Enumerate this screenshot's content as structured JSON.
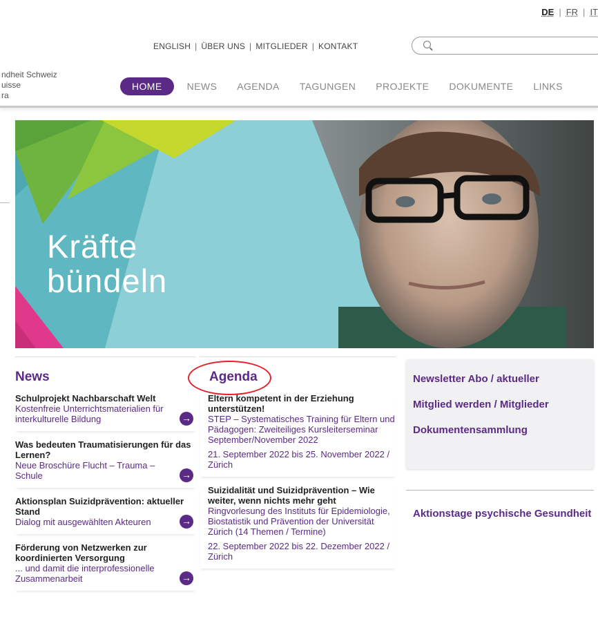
{
  "languages": [
    {
      "label": "DE",
      "active": true
    },
    {
      "label": "FR",
      "active": false
    },
    {
      "label": "IT",
      "active": false
    }
  ],
  "top_links": [
    "ENGLISH",
    "ÜBER UNS",
    "MITGLIEDER",
    "KONTAKT"
  ],
  "search": {
    "value": "",
    "placeholder": ""
  },
  "brand": {
    "line1": "ndheit Schweiz",
    "line2": "uisse",
    "line3": "ra"
  },
  "nav": [
    "HOME",
    "NEWS",
    "AGENDA",
    "TAGUNGEN",
    "PROJEKTE",
    "DOKUMENTE",
    "LINKS"
  ],
  "hero": {
    "line1": "Kräfte",
    "line2": "bündeln"
  },
  "news": {
    "heading": "News",
    "items": [
      {
        "title": "Schulprojekt Nachbarschaft Welt",
        "text": "Kostenfreie Unterrichtsmaterialien für interkulturelle Bildung"
      },
      {
        "title": "Was bedeuten Traumatisierungen für das Lernen?",
        "text": "Neue Broschüre Flucht – Trauma – Schule"
      },
      {
        "title": "Aktionsplan Suizidprävention: aktueller Stand",
        "text": "Dialog mit ausgewählten Akteuren"
      },
      {
        "title": "Förderung von Netzwerken zur koordinierten Versorgung",
        "text": "... und damit die interprofessionelle Zusammenarbeit"
      }
    ]
  },
  "agenda": {
    "heading": "Agenda",
    "items": [
      {
        "title": "Eltern kompetent in der Erziehung unterstützen!",
        "desc": "STEP – Systematisches Training für Eltern und Pädagogen: Zweiteiliges Kursleiterseminar September/November 2022",
        "date": "21. September 2022 bis 25. November 2022 / Zürich"
      },
      {
        "title": "Suizidalität und Suizidprävention – Wie weiter, wenn nichts mehr geht",
        "desc": "Ringvorlesung des Instituts für Epidemiologie, Biostatistik und Prävention der Universität Zürich (14 Themen / Termine)",
        "date": "22. September 2022 bis 22. Dezember 2022 / Zürich"
      }
    ]
  },
  "right": {
    "links": [
      "Newsletter Abo / aktueller",
      "Mitglied werden / Mitglieder",
      "Dokumentensammlung"
    ],
    "extra": "Aktionstage psychische Gesundheit"
  },
  "colors": {
    "accent": "#5b2a86",
    "annotation": "#e8202a",
    "hero_teal": "#6cc0c9",
    "hero_green": "#8cc63f",
    "hero_lime": "#c5d82e",
    "hero_pink": "#e0388b"
  },
  "icons": {
    "arrow": "→"
  }
}
